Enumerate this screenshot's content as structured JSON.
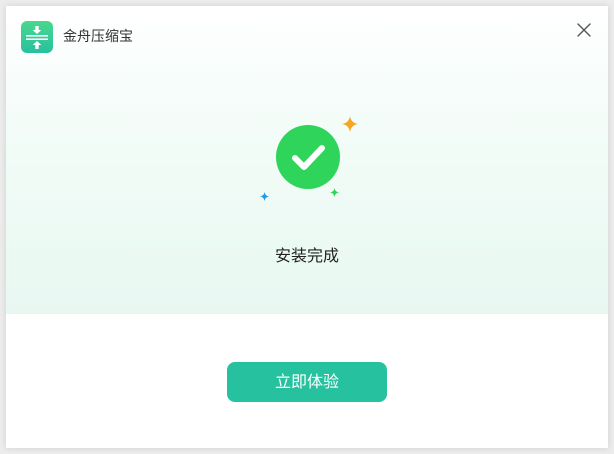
{
  "window": {
    "title": "金舟压缩宝",
    "logo_icon": "compress-arrows-icon",
    "close_icon": "close-icon"
  },
  "install": {
    "status_icon": "check-circle-icon",
    "status_text": "安装完成",
    "primary_button_label": "立即体验"
  },
  "colors": {
    "accent": "#26c2a0",
    "success": "#2fd45a",
    "sparkle_orange": "#f5a623",
    "sparkle_green": "#2fd45a",
    "sparkle_blue": "#1e9be8"
  }
}
